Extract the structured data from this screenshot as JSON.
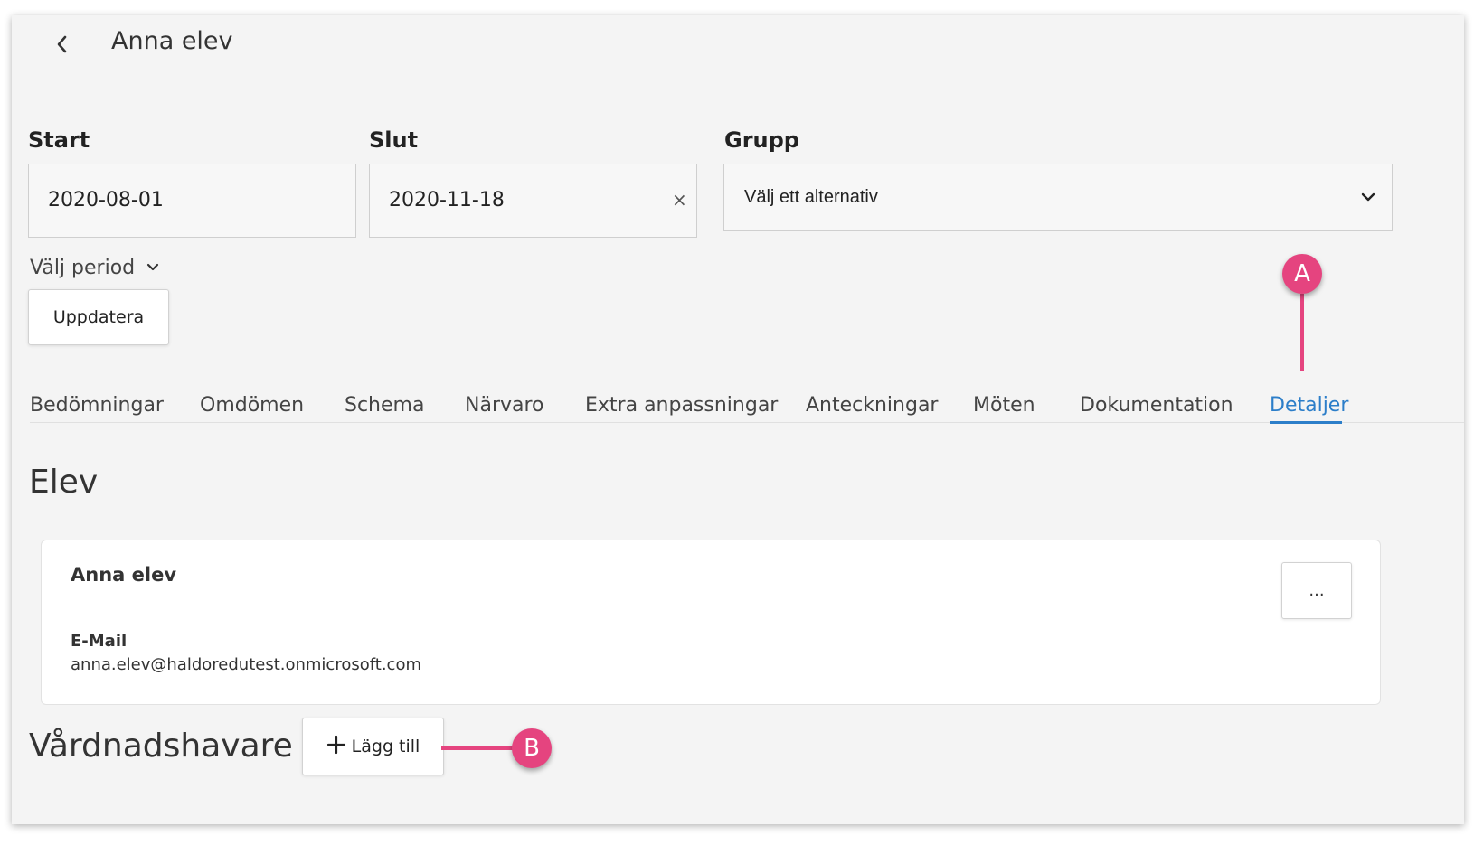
{
  "header": {
    "title": "Anna elev"
  },
  "filters": {
    "start": {
      "label": "Start",
      "value": "2020-08-01"
    },
    "end": {
      "label": "Slut",
      "value": "2020-11-18",
      "clear_icon": "×"
    },
    "group": {
      "label": "Grupp",
      "value": "Välj ett alternativ"
    },
    "period_label": "Välj period",
    "update_button": "Uppdatera"
  },
  "tabs": [
    {
      "label": "Bedömningar"
    },
    {
      "label": "Omdömen"
    },
    {
      "label": "Schema"
    },
    {
      "label": "Närvaro"
    },
    {
      "label": "Extra anpassningar"
    },
    {
      "label": "Anteckningar"
    },
    {
      "label": "Möten"
    },
    {
      "label": "Dokumentation"
    },
    {
      "label": "Detaljer",
      "active": true
    }
  ],
  "student_section": {
    "title": "Elev",
    "name": "Anna elev",
    "email_label": "E-Mail",
    "email": "anna.elev@haldoredutest.onmicrosoft.com",
    "more_button": "..."
  },
  "guardian_section": {
    "title": "Vårdnadshavare",
    "add_button": "Lägg till"
  },
  "annotations": {
    "a": "A",
    "b": "B"
  },
  "colors": {
    "accent": "#2c7ec9",
    "marker": "#e5447f",
    "panel": "#f4f4f4"
  },
  "icons": {
    "back": "chevron-left-icon",
    "period": "chevron-down-icon",
    "select": "chevron-down-icon",
    "add": "plus-icon"
  }
}
